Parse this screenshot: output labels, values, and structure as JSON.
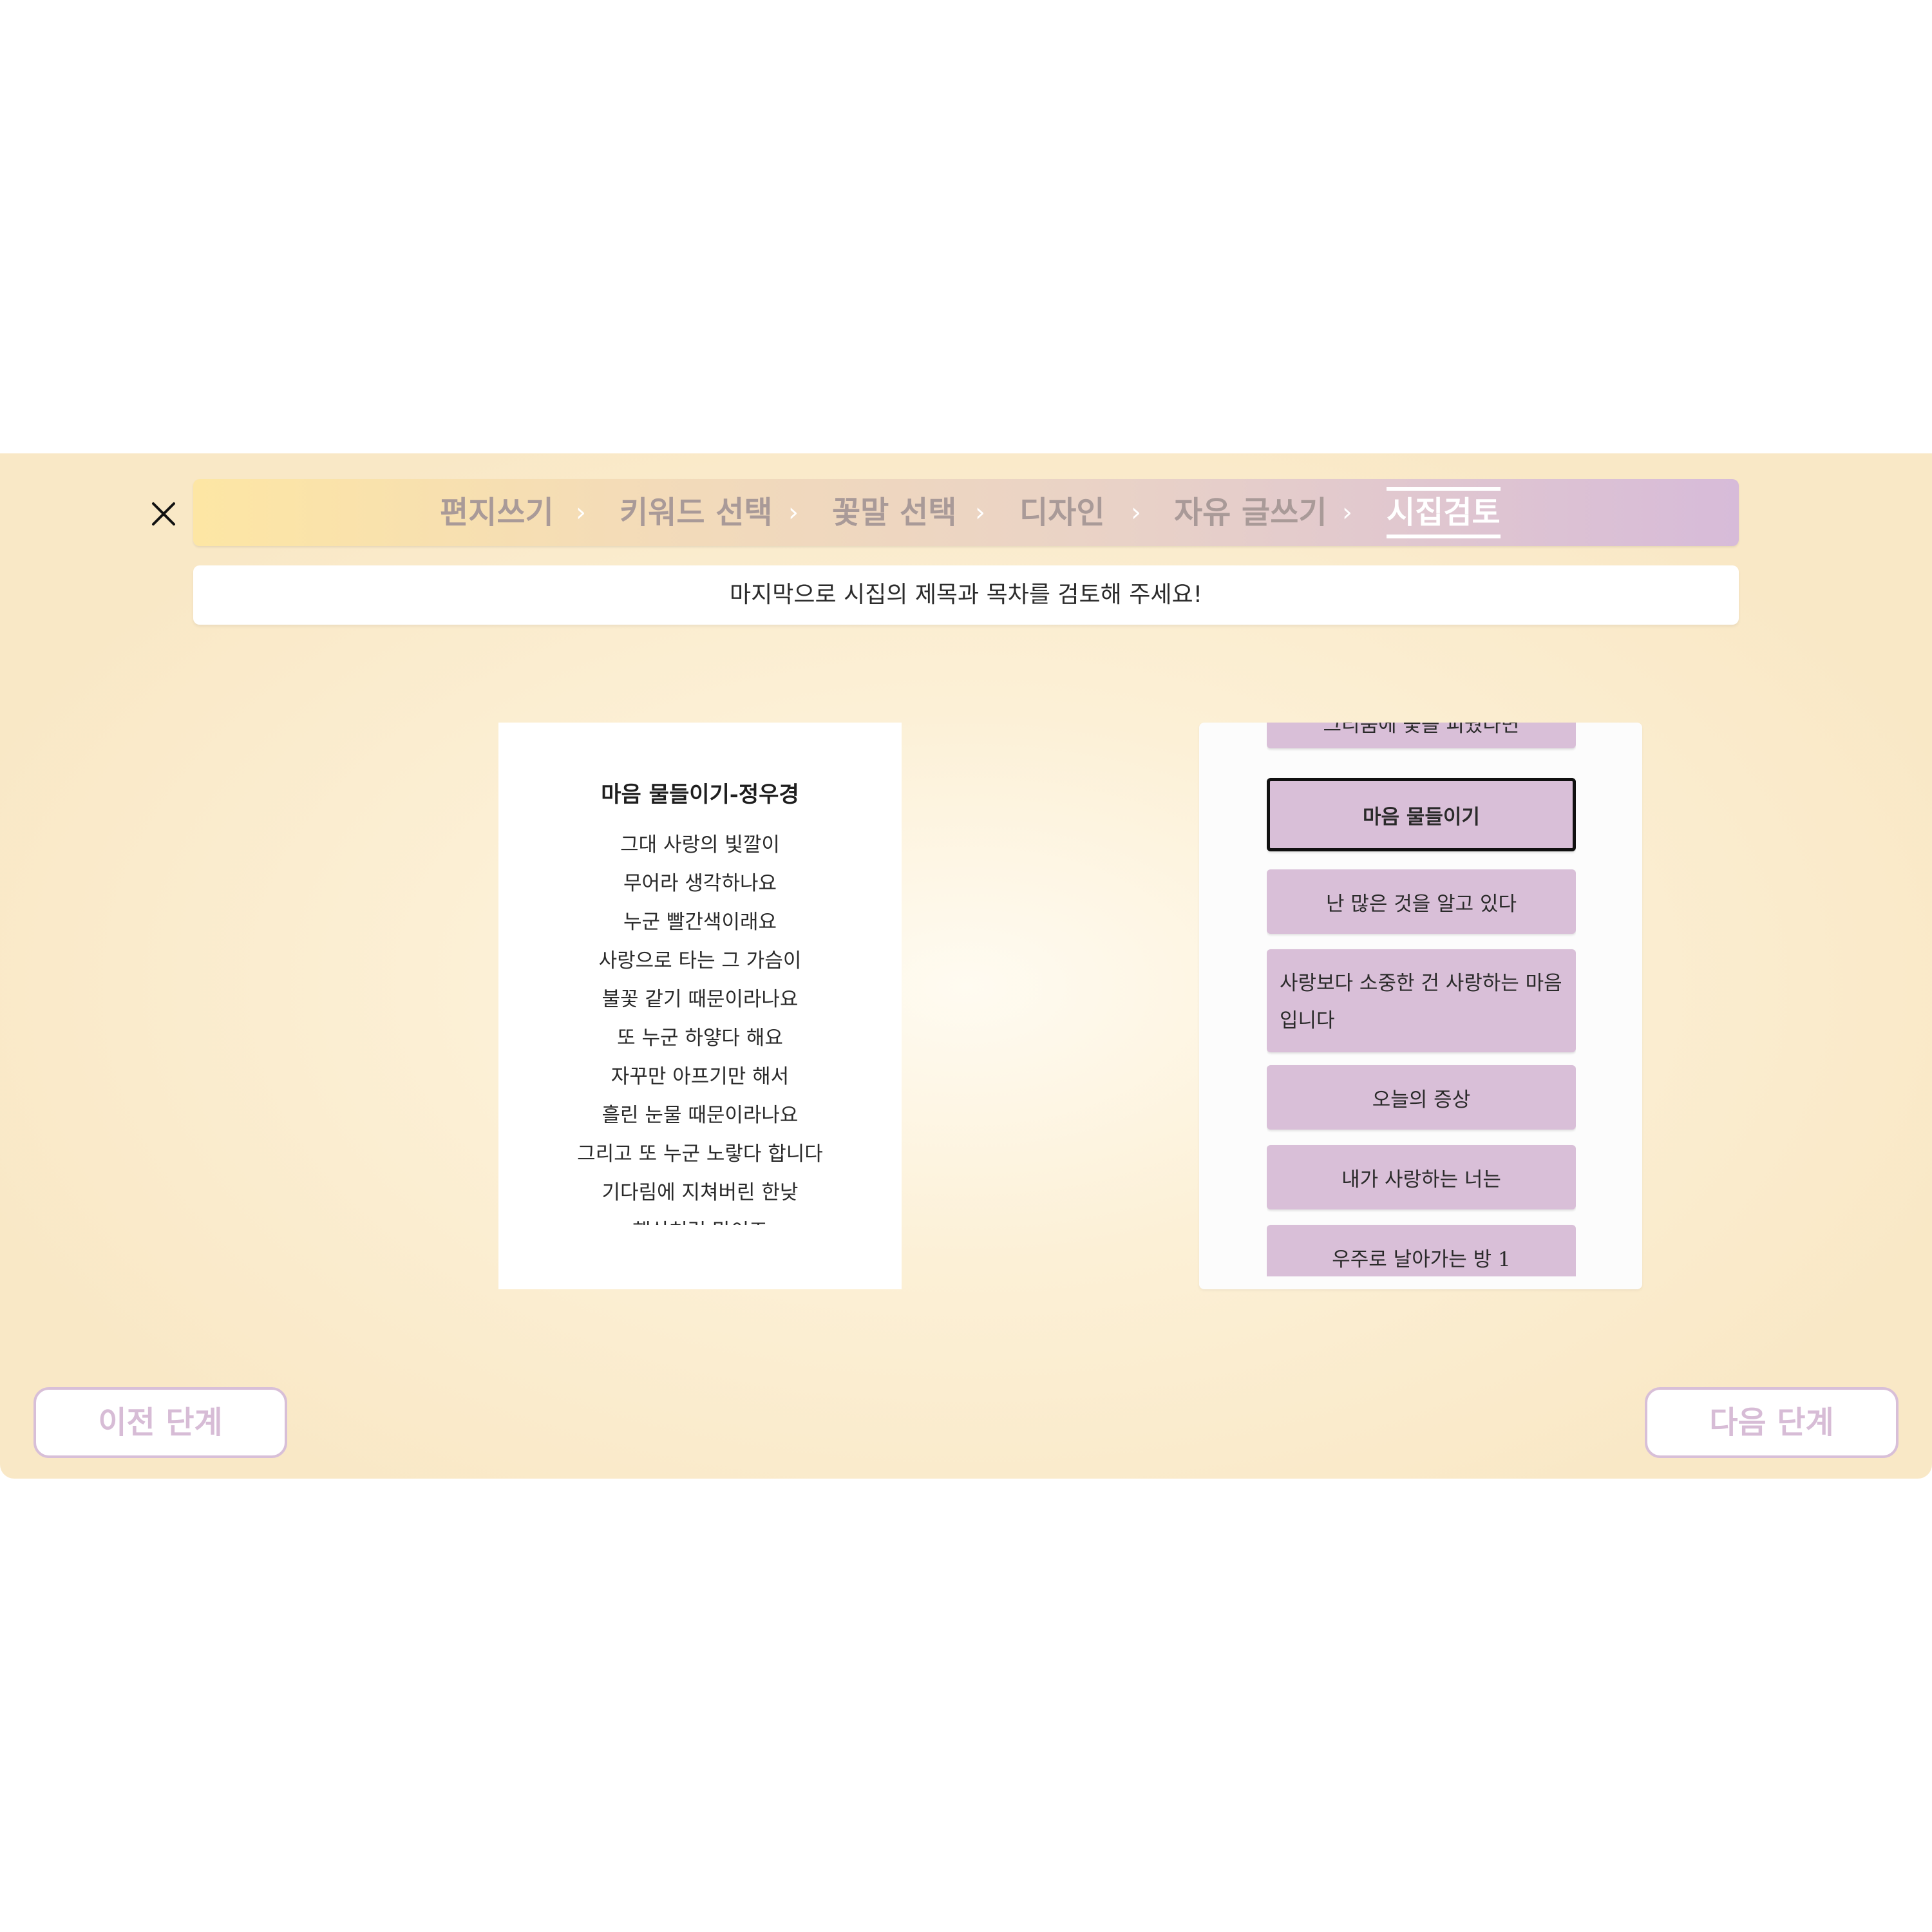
{
  "stepper": {
    "steps": [
      {
        "label": "편지쓰기",
        "active": false
      },
      {
        "label": "키워드 선택",
        "active": false
      },
      {
        "label": "꽃말 선택",
        "active": false
      },
      {
        "label": "디자인",
        "active": false
      },
      {
        "label": "자유 글쓰기",
        "active": false
      },
      {
        "label": "시집검토",
        "active": true
      }
    ],
    "separator": "›"
  },
  "instruction": "마지막으로 시집의 제목과 목차를 검토해 주세요!",
  "poem": {
    "title": "마음 물들이기-정우경",
    "lines": [
      "그대 사랑의 빛깔이",
      "무어라 생각하나요",
      "누군 빨간색이래요",
      "사랑으로 타는 그 가슴이",
      "불꽃 같기 때문이라나요",
      "또 누군 하얗다 해요",
      "자꾸만 아프기만 해서",
      "흘린 눈물 때문이라나요",
      "그리고 또 누군 노랗다 합니다",
      "기다림에 지쳐버린 한낮",
      "햇살처럼 말이죠"
    ]
  },
  "toc": {
    "items": [
      {
        "label": "그리움에 꽃을 피웠다면",
        "selected": false
      },
      {
        "label": "마음 물들이기",
        "selected": true
      },
      {
        "label": "난 많은 것을 알고 있다",
        "selected": false
      },
      {
        "label": "사랑보다 소중한 건 사랑하는 마음입니다",
        "selected": false
      },
      {
        "label": "오늘의 증상",
        "selected": false
      },
      {
        "label": "내가 사랑하는 너는",
        "selected": false
      },
      {
        "label": "우주로 날아가는 방 1",
        "selected": false
      }
    ]
  },
  "navigation": {
    "prev_label": "이전 단계",
    "next_label": "다음 단계"
  },
  "colors": {
    "accent": "#d9bfd8",
    "button_text": "#d7bcd6",
    "step_inactive": "#a99a98",
    "step_active": "#ffffff"
  }
}
